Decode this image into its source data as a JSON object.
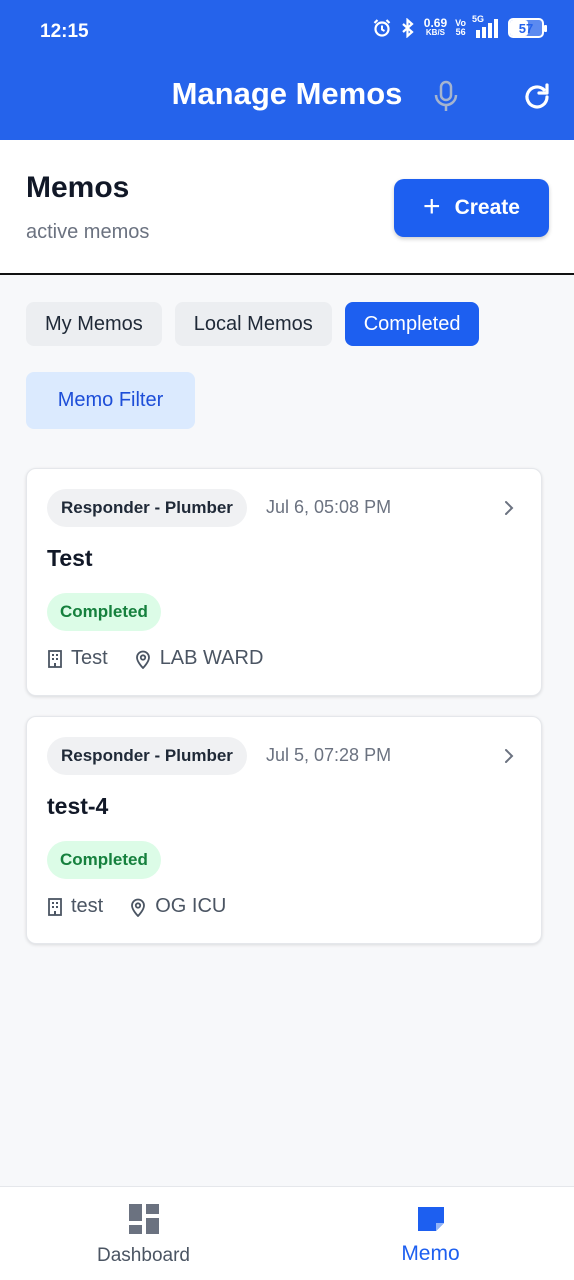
{
  "status_bar": {
    "time": "12:15",
    "net_speed_value": "0.69",
    "net_speed_unit": "KB/S",
    "volte_top": "Vo",
    "volte_bottom": "56",
    "network_type": "5G",
    "battery_level": "57"
  },
  "header": {
    "title": "Manage Memos",
    "icons": [
      "mic-icon",
      "refresh-icon"
    ]
  },
  "page": {
    "title": "Memos",
    "subtitle": "active memos",
    "create_label": "Create"
  },
  "tabs": [
    {
      "label": "My Memos",
      "active": false
    },
    {
      "label": "Local Memos",
      "active": false
    },
    {
      "label": "Completed",
      "active": true
    }
  ],
  "filter": {
    "label": "Memo Filter"
  },
  "memos": [
    {
      "responder": "Responder - Plumber",
      "datetime": "Jul 6, 05:08 PM",
      "title": "Test",
      "status": "Completed",
      "building": "Test",
      "location": "LAB WARD"
    },
    {
      "responder": "Responder - Plumber",
      "datetime": "Jul 5, 07:28 PM",
      "title": "test-4",
      "status": "Completed",
      "building": "test",
      "location": "OG ICU"
    }
  ],
  "bottom_nav": [
    {
      "label": "Dashboard",
      "icon": "dashboard-icon",
      "active": false
    },
    {
      "label": "Memo",
      "icon": "memo-icon",
      "active": true
    }
  ],
  "colors": {
    "primary": "#2563eb",
    "button": "#1d5ff0",
    "status_bg": "#dcfce7",
    "status_text": "#15803d"
  }
}
